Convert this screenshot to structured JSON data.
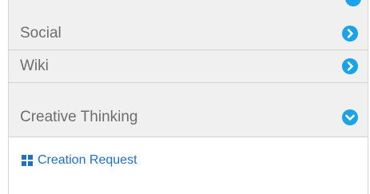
{
  "accordion": {
    "items": [
      {
        "label": "Social",
        "state": "collapsed",
        "icon": "chevron-right-icon"
      },
      {
        "label": "Wiki",
        "state": "collapsed",
        "icon": "chevron-right-icon"
      },
      {
        "label": "Creative Thinking",
        "state": "expanded",
        "icon": "chevron-down-icon"
      }
    ],
    "expanded_content": {
      "links": [
        {
          "label": "Creation Request",
          "icon": "grid-icon"
        }
      ]
    }
  },
  "colors": {
    "accent": "#1aa3e8",
    "link": "#1f6fc5",
    "row_background": "#f0f0f0",
    "row_text": "#6e6e6e"
  }
}
